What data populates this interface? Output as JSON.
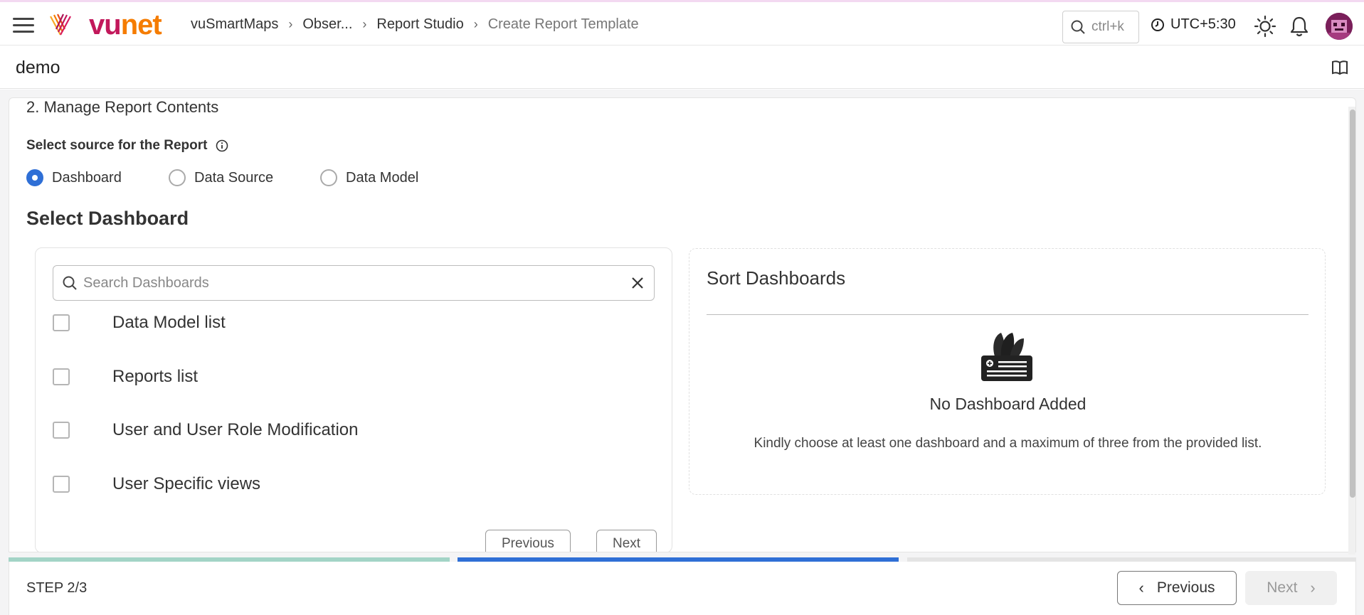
{
  "header": {
    "logo": {
      "part1": "vu",
      "part2": "net"
    },
    "breadcrumb": [
      "vuSmartMaps",
      "Obser...",
      "Report Studio",
      "Create Report Template"
    ],
    "search_shortcut": "ctrl+k",
    "timezone": "UTC+5:30"
  },
  "page": {
    "title": "demo"
  },
  "section": {
    "title": "2. Manage Report Contents",
    "source_label": "Select source for the Report",
    "sources": [
      {
        "label": "Dashboard",
        "selected": true
      },
      {
        "label": "Data Source",
        "selected": false
      },
      {
        "label": "Data Model",
        "selected": false
      }
    ],
    "select_title": "Select Dashboard"
  },
  "dashboard_list": {
    "search_placeholder": "Search Dashboards",
    "items": [
      {
        "label": "Data Model list",
        "checked": false
      },
      {
        "label": "Reports list",
        "checked": false
      },
      {
        "label": "User and User Role Modification",
        "checked": false
      },
      {
        "label": "User Specific views",
        "checked": false
      }
    ],
    "prev_label": "Previous",
    "next_label": "Next"
  },
  "sort_panel": {
    "title": "Sort Dashboards",
    "empty_title": "No Dashboard Added",
    "empty_desc": "Kindly choose at least one dashboard and a maximum of three from the provided list."
  },
  "footer": {
    "step": "STEP 2/3",
    "prev_label": "Previous",
    "next_label": "Next",
    "current_step": 2,
    "total_steps": 3
  },
  "colors": {
    "accent": "#2f6fd6",
    "step_done": "#a3d4c6",
    "step_active": "#2f6fd6",
    "step_pending": "#e4e4e4"
  }
}
